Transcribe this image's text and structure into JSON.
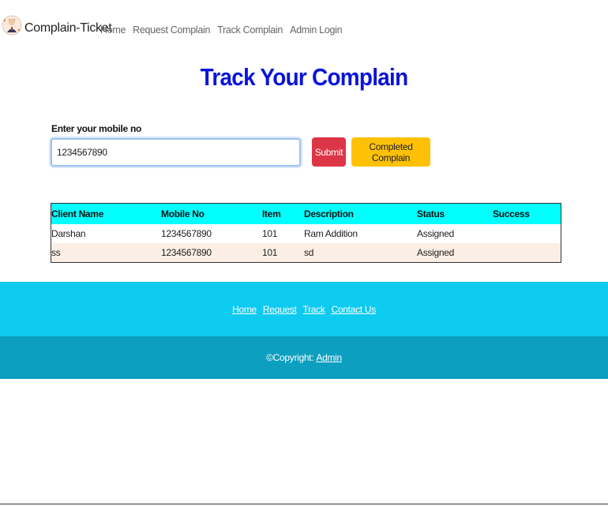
{
  "nav": {
    "brand": "Complain-Ticket",
    "links": [
      "Home",
      "Request Complain",
      "Track Complain",
      "Admin Login"
    ]
  },
  "page": {
    "title": "Track Your Complain"
  },
  "form": {
    "label": "Enter your mobile no",
    "mobile_value": "1234567890",
    "submit_label": "Submit",
    "completed_label": "Completed Complain"
  },
  "table": {
    "headers": [
      "Client Name",
      "Mobile No",
      "Item",
      "Description",
      "Status",
      "Success"
    ],
    "rows": [
      [
        "Darshan",
        "1234567890",
        "101",
        "Ram Addition",
        "Assigned",
        ""
      ],
      [
        "ss",
        "1234567890",
        "101",
        "sd",
        "Assigned",
        ""
      ]
    ]
  },
  "footer": {
    "links": [
      "Home",
      "Request",
      "Track",
      "Contact Us"
    ],
    "copyright_text": "©Copyright:",
    "copyright_link": "Admin"
  },
  "colors": {
    "title": "#0a14d8",
    "submit": "#dc3545",
    "completed": "#ffc107",
    "table_header": "#00ffff",
    "footer_top": "#0dcaf0",
    "footer_bottom": "#0c9fc0"
  }
}
